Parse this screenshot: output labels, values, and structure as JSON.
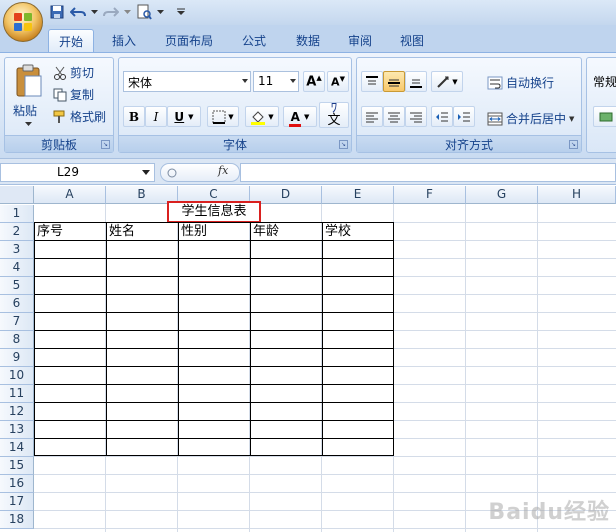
{
  "tabs": [
    "开始",
    "插入",
    "页面布局",
    "公式",
    "数据",
    "审阅",
    "视图"
  ],
  "active_tab": "开始",
  "clipboard": {
    "paste_label": "粘贴",
    "cut_label": "剪切",
    "copy_label": "复制",
    "format_painter_label": "格式刷",
    "group_label": "剪贴板"
  },
  "font": {
    "font_name": "宋体",
    "font_size": "11",
    "bold": "B",
    "italic": "I",
    "underline": "U",
    "font_color_label": "A",
    "group_label": "字体"
  },
  "alignment": {
    "wrap_text_label": "自动换行",
    "merge_center_label": "合并后居中",
    "group_label": "对齐方式"
  },
  "number": {
    "format_label": "常规"
  },
  "formula_bar": {
    "name_box": "L29",
    "fx_label": "fx",
    "value": ""
  },
  "columns": [
    "A",
    "B",
    "C",
    "D",
    "E",
    "F",
    "G",
    "H"
  ],
  "rows": [
    "1",
    "2",
    "3",
    "4",
    "5",
    "6",
    "7",
    "8",
    "9",
    "10",
    "11",
    "12",
    "13",
    "14",
    "15",
    "16",
    "17",
    "18"
  ],
  "sheet": {
    "title_cell": "学生信息表",
    "headers": [
      "序号",
      "姓名",
      "性别",
      "年龄",
      "学校"
    ]
  },
  "watermark": "Baidu经验"
}
